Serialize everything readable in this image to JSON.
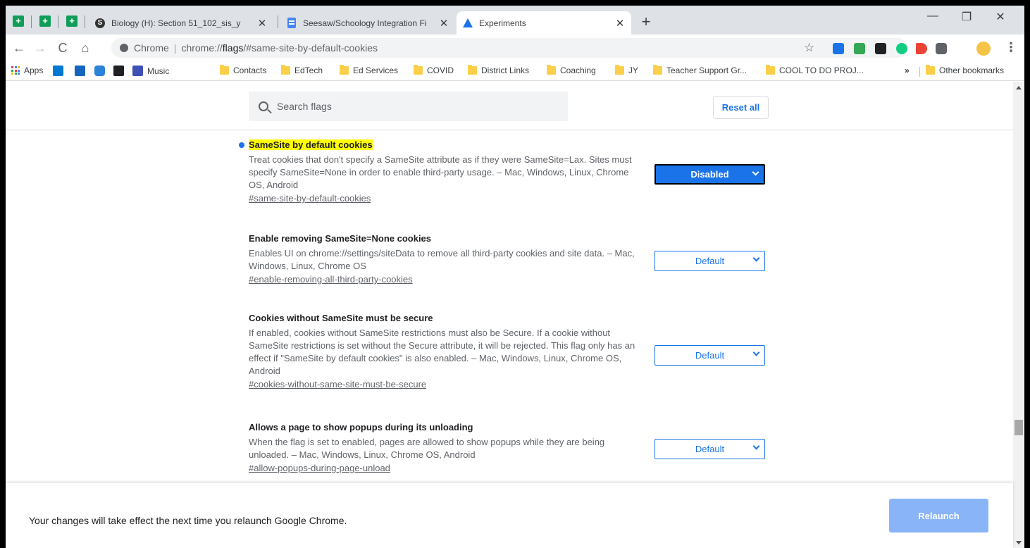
{
  "tabs": [
    {
      "title": "Biology (H): Section 51_102_sis_y",
      "close": "✕"
    },
    {
      "title": "Seesaw/Schoology Integration Fi",
      "close": "✕"
    },
    {
      "title": "Experiments",
      "close": "✕",
      "active": true
    }
  ],
  "window_controls": {
    "minimize": "—",
    "restore": "❐",
    "close": "✕"
  },
  "toolbar": {
    "back": "←",
    "forward": "→",
    "reload": "C",
    "home": "⌂",
    "scheme": "Chrome",
    "url_prefix": "chrome://",
    "url_host": "flags",
    "url_rest": "/#same-site-by-default-cookies",
    "star": "☆",
    "menu": "⋮"
  },
  "bookmarks": {
    "apps": "Apps",
    "items": [
      "Music",
      "Contacts",
      "EdTech",
      "Ed Services",
      "COVID",
      "District Links",
      "Coaching",
      "JY",
      "Teacher Support Gr...",
      "COOL TO DO PROJ..."
    ],
    "overflow": "»",
    "other": "Other bookmarks"
  },
  "search": {
    "placeholder": "Search flags",
    "reset_label": "Reset all"
  },
  "flags": [
    {
      "title": "SameSite by default cookies",
      "description": "Treat cookies that don't specify a SameSite attribute as if they were SameSite=Lax. Sites must specify SameSite=None in order to enable third-party usage. – Mac, Windows, Linux, Chrome OS, Android",
      "link": "#same-site-by-default-cookies",
      "value": "Disabled"
    },
    {
      "title": "Enable removing SameSite=None cookies",
      "description": "Enables UI on chrome://settings/siteData to remove all third-party cookies and site data. – Mac, Windows, Linux, Chrome OS",
      "link": "#enable-removing-all-third-party-cookies",
      "value": "Default"
    },
    {
      "title": "Cookies without SameSite must be secure",
      "description": "If enabled, cookies without SameSite restrictions must also be Secure. If a cookie without SameSite restrictions is set without the Secure attribute, it will be rejected. This flag only has an effect if \"SameSite by default cookies\" is also enabled. – Mac, Windows, Linux, Chrome OS, Android",
      "link": "#cookies-without-same-site-must-be-secure",
      "value": "Default"
    },
    {
      "title": "Allows a page to show popups during its unloading",
      "description": "When the flag is set to enabled, pages are allowed to show popups while they are being unloaded. – Mac, Windows, Linux, Chrome OS, Android",
      "link": "#allow-popups-during-page-unload",
      "value": "Default"
    }
  ],
  "relaunch": {
    "message": "Your changes will take effect the next time you relaunch Google Chrome.",
    "button": "Relaunch"
  },
  "colors": {
    "accent": "#1a73e8",
    "highlight": "#ffff00",
    "relaunch": "#8ab4f8",
    "sheets": "#0f9d58"
  }
}
